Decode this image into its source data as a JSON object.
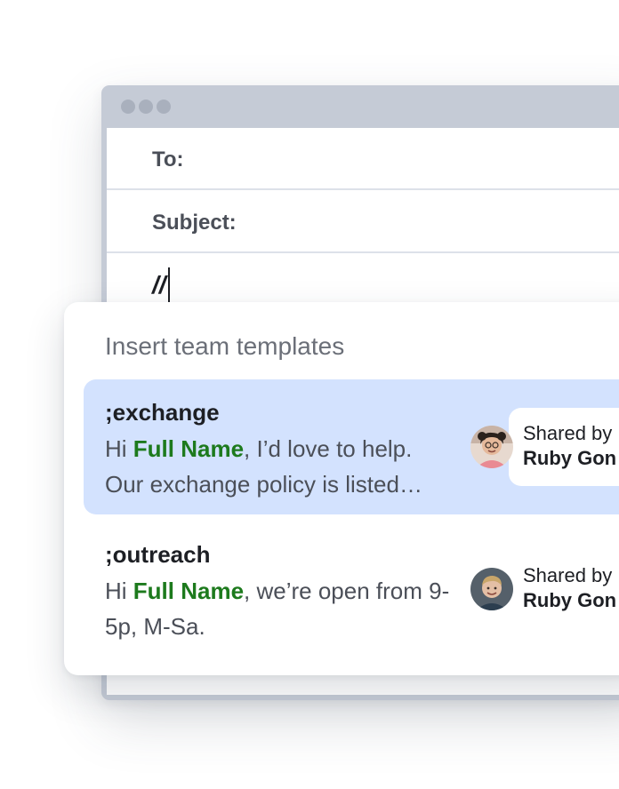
{
  "email": {
    "to_label": "To:",
    "subject_label": "Subject:",
    "body_text": "//"
  },
  "popup": {
    "title": "Insert team templates",
    "templates": [
      {
        "shortcut": ";exchange",
        "preview_before": "Hi ",
        "variable": "Full Name",
        "preview_after": ", I’d love to help. Our exchange policy is listed…",
        "shared_label": "Shared by",
        "shared_by": "Ruby Gon",
        "selected": true
      },
      {
        "shortcut": ";outreach",
        "preview_before": "Hi ",
        "variable": "Full Name",
        "preview_after": ", we’re open from 9-5p, M-Sa.",
        "shared_label": "Shared by",
        "shared_by": "Ruby Gon",
        "selected": false
      }
    ]
  },
  "colors": {
    "window_frame": "#c5cbd6",
    "selected_row": "#d3e2fe",
    "variable_text": "#1d7a1d"
  }
}
